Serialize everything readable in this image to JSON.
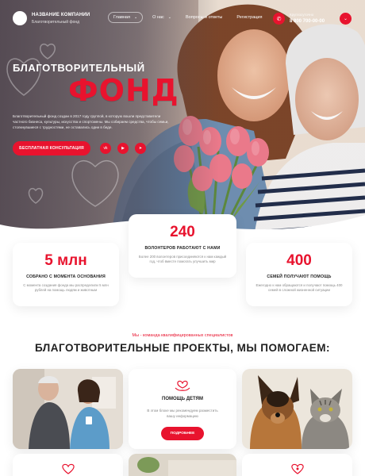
{
  "brand": {
    "name": "НАЗВАНИЕ КОМПАНИИ",
    "tagline": "Благотворительный фонд"
  },
  "nav": [
    {
      "label": "Главная",
      "caret": "⌄",
      "active": true
    },
    {
      "label": "О нас",
      "caret": "⌄",
      "active": false
    },
    {
      "label": "Вопросы и ответы",
      "caret": "",
      "active": false
    },
    {
      "label": "Регистрация",
      "caret": "",
      "active": false
    }
  ],
  "contact": {
    "label": "Круглосуточно",
    "phone": "8 800 700-00-00"
  },
  "hero": {
    "title_line1": "БЛАГОТВОРИТЕЛЬНЫЙ",
    "title_line2": "ФОНД",
    "description": "Благотворительный фонд создан в 2017 году группой, в которую вошли представители частного бизнеса, культуры, искусства и спортсмены. Мы собираем средства, чтобы семьи, столкнувшиеся с трудностями, не оставались одни в беде.",
    "cta_label": "БЕСПЛАТНАЯ КОНСУЛЬТАЦИЯ",
    "social_icons": [
      "vk-icon",
      "youtube-icon",
      "telegram-icon"
    ]
  },
  "stats": [
    {
      "value": "5 млн",
      "title": "СОБРАНО С МОМЕНТА ОСНОВАНИЯ",
      "description": "С момента создания фонда мы распределили 5 млн рублей на помощь людям и животным"
    },
    {
      "value": "240",
      "title": "ВОЛОНТЕРОВ РАБОТАЮТ С НАМИ",
      "description": "Более 200 волонтеров присоединяются к нам каждый год, чтоб вместе помогать улучшить мир"
    },
    {
      "value": "400",
      "title": "СЕМЕЙ ПОЛУЧАЮТ ПОМОЩЬ",
      "description": "Ежегодно к нам обращаются и получают помощь 400 семей в сложной жизненной ситуации"
    }
  ],
  "section": {
    "subtitle": "Мы - команда квалифицированных специалистов",
    "title": "БЛАГОТВОРИТЕЛЬНЫЕ ПРОЕКТЫ, МЫ ПОМОГАЕМ:"
  },
  "project_card": {
    "icon": "heart-hands-icon",
    "title": "ПОМОЩЬ ДЕТЯМ",
    "description": "В этом блоке мы рекомендуем разместить вашу информацию",
    "button_label": "ПОДРОБНЕЕ"
  },
  "colors": {
    "accent": "#e8132e"
  }
}
